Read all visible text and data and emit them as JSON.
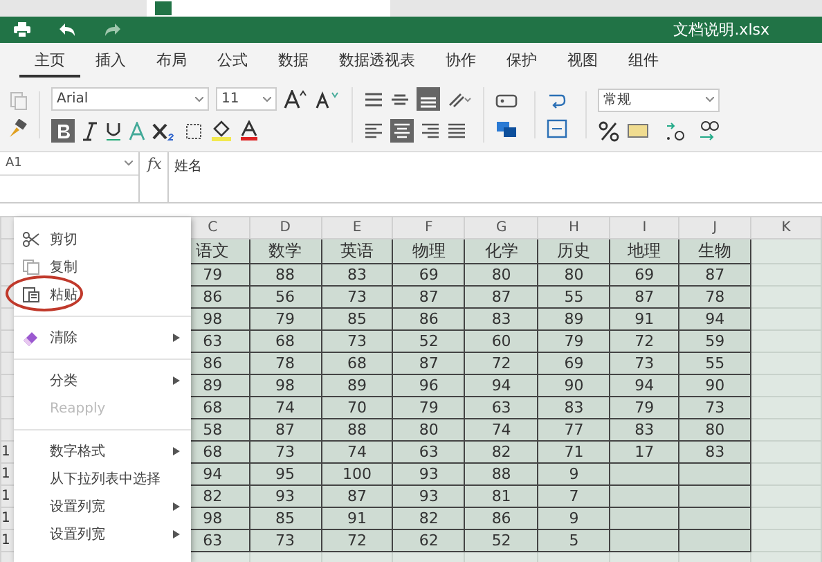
{
  "title_bar": {
    "document": "文档说明.xlsx"
  },
  "ribbon_tabs": [
    {
      "label": "主页",
      "selected": true
    },
    {
      "label": "插入",
      "selected": false
    },
    {
      "label": "布局",
      "selected": false
    },
    {
      "label": "公式",
      "selected": false
    },
    {
      "label": "数据",
      "selected": false
    },
    {
      "label": "数据透视表",
      "selected": false
    },
    {
      "label": "协作",
      "selected": false
    },
    {
      "label": "保护",
      "selected": false
    },
    {
      "label": "视图",
      "selected": false
    },
    {
      "label": "组件",
      "selected": false
    }
  ],
  "toolbar": {
    "font": "Arial",
    "size": "11",
    "bold": true,
    "number_format": "常规"
  },
  "formula_bar": {
    "cell": "A1",
    "fx": "fx",
    "value": "姓名"
  },
  "sheet": {
    "columns": [
      "C",
      "D",
      "E",
      "F",
      "G",
      "H",
      "I",
      "J",
      "K"
    ],
    "rows": [
      {
        "cells": [
          "语文",
          "数学",
          "英语",
          "物理",
          "化学",
          "历史",
          "地理",
          "生物"
        ]
      },
      {
        "cells": [
          "79",
          "88",
          "83",
          "69",
          "80",
          "80",
          "69",
          "87"
        ]
      },
      {
        "cells": [
          "86",
          "56",
          "73",
          "87",
          "87",
          "55",
          "87",
          "78"
        ]
      },
      {
        "cells": [
          "98",
          "79",
          "85",
          "86",
          "83",
          "89",
          "91",
          "94"
        ]
      },
      {
        "cells": [
          "63",
          "68",
          "73",
          "52",
          "60",
          "79",
          "72",
          "59"
        ]
      },
      {
        "cells": [
          "86",
          "78",
          "68",
          "87",
          "72",
          "69",
          "73",
          "55"
        ]
      },
      {
        "cells": [
          "89",
          "98",
          "89",
          "96",
          "94",
          "90",
          "94",
          "90"
        ]
      },
      {
        "cells": [
          "68",
          "74",
          "70",
          "79",
          "63",
          "83",
          "79",
          "73"
        ]
      },
      {
        "cells": [
          "58",
          "87",
          "88",
          "80",
          "74",
          "77",
          "83",
          "80"
        ]
      },
      {
        "row_label": "1",
        "cells": [
          "68",
          "73",
          "74",
          "63",
          "82",
          "71",
          "17",
          "83"
        ]
      },
      {
        "row_label": "1",
        "cells": [
          "94",
          "95",
          "100",
          "93",
          "88",
          "9"
        ]
      },
      {
        "row_label": "1",
        "cells": [
          "82",
          "93",
          "87",
          "93",
          "81",
          "7"
        ]
      },
      {
        "row_label": "1",
        "cells": [
          "98",
          "85",
          "91",
          "82",
          "86",
          "9"
        ]
      },
      {
        "row_label": "1",
        "cells": [
          "63",
          "73",
          "72",
          "62",
          "52",
          "5"
        ]
      },
      {
        "cells": []
      }
    ]
  },
  "context_menu": {
    "items": [
      {
        "kind": "cut",
        "label": "剪切",
        "submenu": false,
        "disabled": false,
        "circled": false
      },
      {
        "kind": "copy",
        "label": "复制",
        "submenu": false,
        "disabled": false,
        "circled": false
      },
      {
        "kind": "paste",
        "label": "粘贴",
        "submenu": false,
        "disabled": false,
        "circled": true
      },
      {
        "kind": "separator"
      },
      {
        "kind": "clear",
        "label": "清除",
        "submenu": true,
        "disabled": false,
        "circled": false
      },
      {
        "kind": "separator"
      },
      {
        "kind": "plain",
        "label": "分类",
        "submenu": true,
        "disabled": false,
        "circled": false
      },
      {
        "kind": "plain",
        "label": "Reapply",
        "submenu": false,
        "disabled": true,
        "circled": false
      },
      {
        "kind": "separator"
      },
      {
        "kind": "plain",
        "label": "数字格式",
        "submenu": true,
        "disabled": false,
        "circled": false
      },
      {
        "kind": "plain",
        "label": "从下拉列表中选择",
        "submenu": false,
        "disabled": false,
        "circled": false
      },
      {
        "kind": "plain",
        "label": "设置列宽",
        "submenu": true,
        "disabled": false,
        "circled": false
      },
      {
        "kind": "plain",
        "label": "设置列宽",
        "submenu": true,
        "disabled": false,
        "circled": false
      }
    ]
  }
}
